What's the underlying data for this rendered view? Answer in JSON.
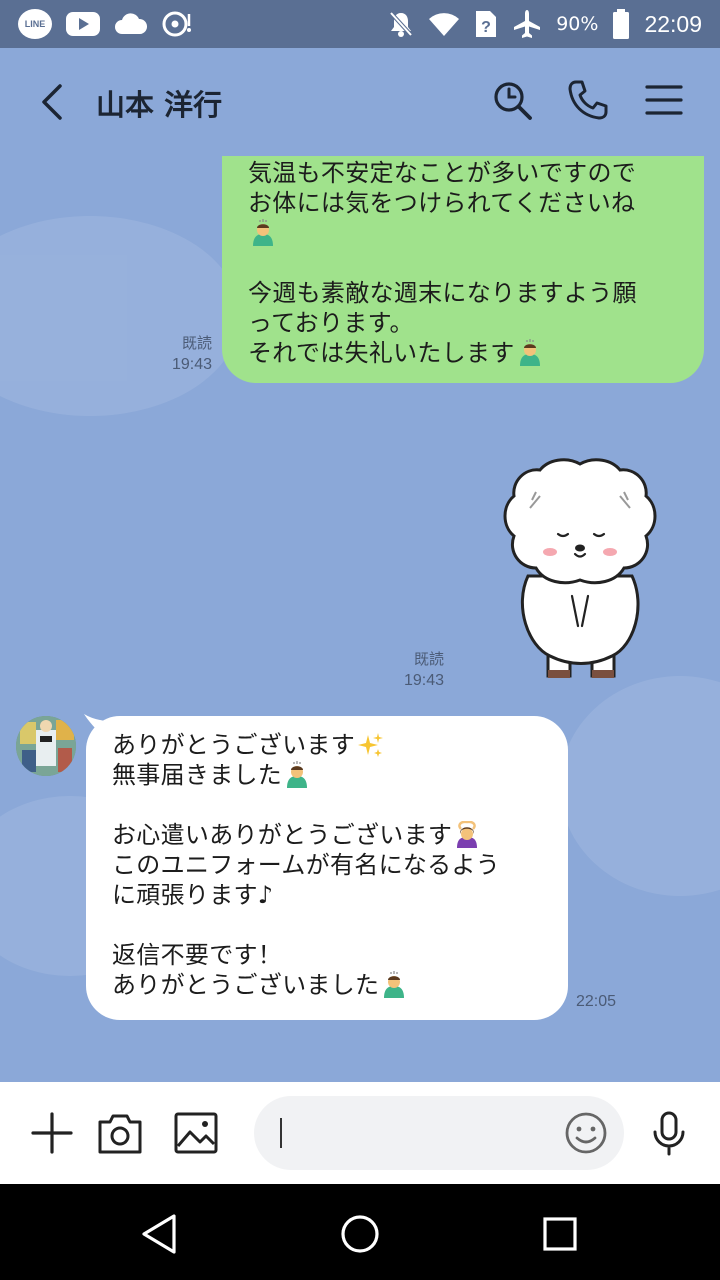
{
  "status_bar": {
    "line_logo_text": "LINE",
    "battery_percent": "90%",
    "time": "22:09",
    "icons": [
      "line-icon",
      "youtube-icon",
      "cloud-icon",
      "music-icon",
      "mute-icon",
      "wifi-icon",
      "unknown-sim-icon",
      "airplane-icon",
      "battery-icon"
    ]
  },
  "header": {
    "contact_name": "山本 洋行",
    "icons": [
      "back-icon",
      "search-icon",
      "phone-icon",
      "menu-icon"
    ]
  },
  "messages": [
    {
      "direction": "outgoing",
      "lines": [
        {
          "text": "気温も不安定なことが多いですので",
          "emoji": ""
        },
        {
          "text": "お体には気をつけられてくださいね",
          "emoji": ""
        },
        {
          "text": "",
          "emoji": "person-bowing"
        },
        {
          "text": "",
          "emoji": ""
        },
        {
          "text": "今週も素敵な週末になりますよう願",
          "emoji": ""
        },
        {
          "text": "っております。",
          "emoji": ""
        },
        {
          "text": "それでは失礼いたします",
          "emoji": "person-bowing"
        }
      ],
      "read_label": "既読",
      "time": "19:43"
    },
    {
      "direction": "outgoing",
      "type": "sticker",
      "sticker": "white-sheep-bowing",
      "read_label": "既読",
      "time": "19:43"
    },
    {
      "direction": "incoming",
      "lines": [
        {
          "text": "ありがとうございます",
          "emoji": "sparkles"
        },
        {
          "text": "無事届きました",
          "emoji": "person-bowing"
        },
        {
          "text": "",
          "emoji": ""
        },
        {
          "text": "お心遣いありがとうございます",
          "emoji": "person-gesturing-ok"
        },
        {
          "text": "このユニフォームが有名になるよう",
          "emoji": ""
        },
        {
          "text": "に頑張ります♪",
          "emoji": ""
        },
        {
          "text": "",
          "emoji": ""
        },
        {
          "text": "返信不要です！",
          "emoji": ""
        },
        {
          "text": "ありがとうございました",
          "emoji": "person-bowing"
        }
      ],
      "time": "22:05"
    }
  ],
  "input_bar": {
    "placeholder": "",
    "icons": [
      "plus-icon",
      "camera-icon",
      "image-icon",
      "emoji-icon",
      "microphone-icon"
    ]
  },
  "nav_bar": {
    "icons": [
      "back-triangle-icon",
      "home-circle-icon",
      "recents-square-icon"
    ]
  },
  "colors": {
    "status_bar_bg": "#5a6f93",
    "chat_bg": "#8ba8d8",
    "outgoing_bubble": "#a0e28c",
    "incoming_bubble": "#ffffff",
    "meta_text": "#4b5b76"
  }
}
